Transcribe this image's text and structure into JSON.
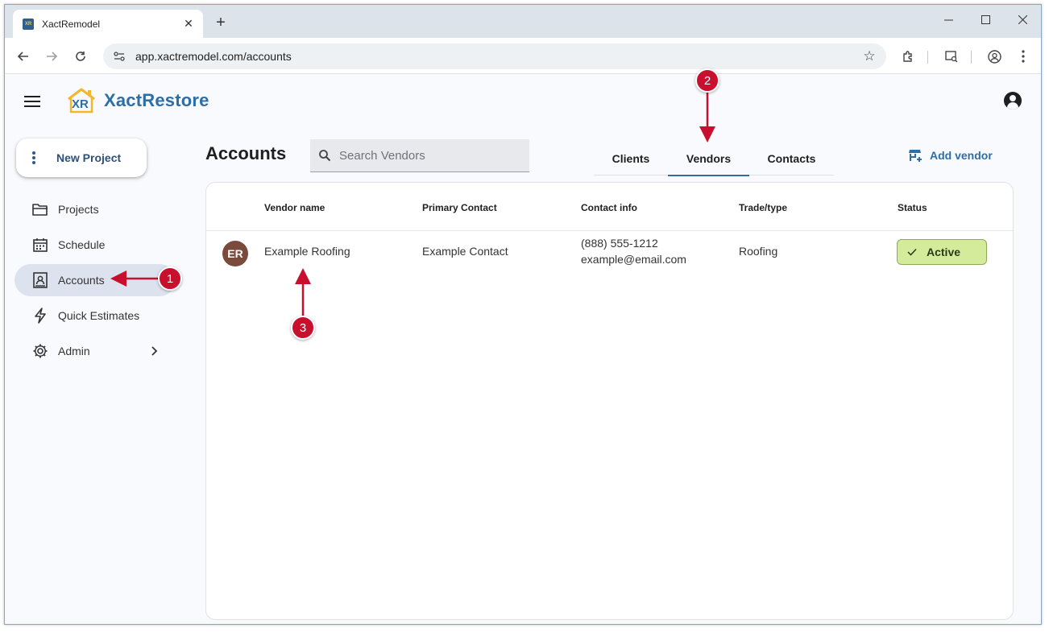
{
  "browser": {
    "tab_title": "XactRemodel",
    "new_tab_symbol": "+",
    "url": "app.xactremodel.com/accounts"
  },
  "app": {
    "brand_mark": "XR",
    "brand_name": "XactRestore",
    "new_project_label": "New Project",
    "nav": [
      {
        "label": "Projects",
        "icon": "folder-icon"
      },
      {
        "label": "Schedule",
        "icon": "calendar-icon"
      },
      {
        "label": "Accounts",
        "icon": "contact-card-icon",
        "active": true
      },
      {
        "label": "Quick Estimates",
        "icon": "lightning-icon"
      },
      {
        "label": "Admin",
        "icon": "gear-icon"
      }
    ]
  },
  "main": {
    "title": "Accounts",
    "search_placeholder": "Search Vendors",
    "tabs": [
      {
        "label": "Clients"
      },
      {
        "label": "Vendors",
        "active": true
      },
      {
        "label": "Contacts"
      }
    ],
    "add_vendor_label": "Add vendor"
  },
  "table": {
    "columns": [
      "Vendor name",
      "Primary Contact",
      "Contact info",
      "Trade/type",
      "Status"
    ],
    "rows": [
      {
        "initials": "ER",
        "vendor_name": "Example Roofing",
        "primary_contact": "Example Contact",
        "phone": "(888) 555-1212",
        "email": "example@email.com",
        "trade": "Roofing",
        "status": "Active"
      }
    ]
  },
  "annotations": [
    "1",
    "2",
    "3"
  ],
  "colors": {
    "accent": "#2e6ea6",
    "callout": "#c8102e",
    "status_active_bg": "#d4eb9c",
    "avatar_bg": "#7a4a3c",
    "nav_active_bg": "#dde3ee"
  }
}
